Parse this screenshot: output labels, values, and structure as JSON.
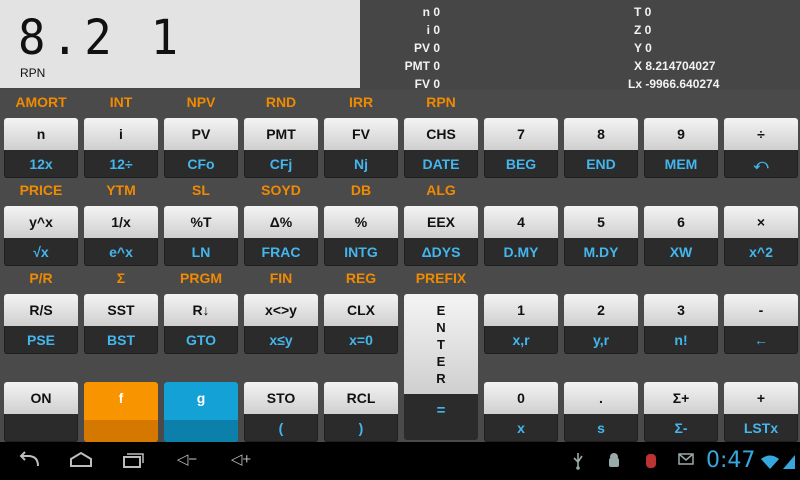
{
  "display": {
    "value": "8.2 1",
    "mode": "RPN"
  },
  "registers_left": [
    "n 0",
    "i 0",
    "PV 0",
    "PMT 0",
    "FV 0"
  ],
  "registers_right": [
    "T 0",
    "Z 0",
    "Y 0",
    "X 8.214704027",
    "Lx -9966.640274"
  ],
  "rows": [
    {
      "flabels": [
        "AMORT",
        "INT",
        "NPV",
        "RND",
        "IRR",
        "RPN",
        "",
        "",
        "",
        ""
      ],
      "keys": [
        {
          "main": "n",
          "sub": "12x"
        },
        {
          "main": "i",
          "sub": "12÷"
        },
        {
          "main": "PV",
          "sub": "CFo"
        },
        {
          "main": "PMT",
          "sub": "CFj"
        },
        {
          "main": "FV",
          "sub": "Nj"
        },
        {
          "main": "CHS",
          "sub": "DATE"
        },
        {
          "main": "7",
          "sub": "BEG"
        },
        {
          "main": "8",
          "sub": "END"
        },
        {
          "main": "9",
          "sub": "MEM"
        },
        {
          "main": "÷",
          "sub": "⤺"
        }
      ]
    },
    {
      "flabels": [
        "PRICE",
        "YTM",
        "SL",
        "SOYD",
        "DB",
        "ALG",
        "",
        "",
        "",
        ""
      ],
      "keys": [
        {
          "main": "y^x",
          "sub": "√x"
        },
        {
          "main": "1/x",
          "sub": "e^x"
        },
        {
          "main": "%T",
          "sub": "LN"
        },
        {
          "main": "Δ%",
          "sub": "FRAC"
        },
        {
          "main": "%",
          "sub": "INTG"
        },
        {
          "main": "EEX",
          "sub": "ΔDYS"
        },
        {
          "main": "4",
          "sub": "D.MY"
        },
        {
          "main": "5",
          "sub": "M.DY"
        },
        {
          "main": "6",
          "sub": "XW"
        },
        {
          "main": "×",
          "sub": "x^2"
        }
      ]
    },
    {
      "flabels": [
        "P/R",
        "Σ",
        "PRGM",
        "FIN",
        "REG",
        "PREFIX",
        "",
        "",
        "",
        ""
      ],
      "keys": [
        {
          "main": "R/S",
          "sub": "PSE"
        },
        {
          "main": "SST",
          "sub": "BST"
        },
        {
          "main": "R↓",
          "sub": "GTO"
        },
        {
          "main": "x<>y",
          "sub": "x≤y"
        },
        {
          "main": "CLX",
          "sub": "x=0"
        },
        null,
        {
          "main": "1",
          "sub": "x,r"
        },
        {
          "main": "2",
          "sub": "y,r"
        },
        {
          "main": "3",
          "sub": "n!"
        },
        {
          "main": "-",
          "sub": "←"
        }
      ]
    },
    {
      "flabels": [
        "",
        "",
        "",
        "",
        "",
        "",
        "",
        "",
        "",
        ""
      ],
      "keys": [
        {
          "main": "ON",
          "sub": ""
        },
        {
          "main": "f",
          "sub": "",
          "variant": "k-f"
        },
        {
          "main": "g",
          "sub": "",
          "variant": "k-g"
        },
        {
          "main": "STO",
          "sub": "("
        },
        {
          "main": "RCL",
          "sub": ")"
        },
        null,
        {
          "main": "0",
          "sub": "x"
        },
        {
          "main": ".",
          "sub": "s"
        },
        {
          "main": "Σ+",
          "sub": "Σ-"
        },
        {
          "main": "+",
          "sub": "LSTx"
        }
      ]
    }
  ],
  "enter_key": {
    "letters": [
      "E",
      "N",
      "T",
      "E",
      "R"
    ],
    "sub": "="
  },
  "navbar": {
    "back_icon": "back-arrow-icon",
    "home_icon": "home-icon",
    "recents_icon": "recent-apps-icon",
    "vol_down_icon": "volume-down-icon",
    "vol_up_icon": "volume-up-icon",
    "vol_down_label": "◁−",
    "vol_up_label": "◁+",
    "clock": "0:47"
  }
}
